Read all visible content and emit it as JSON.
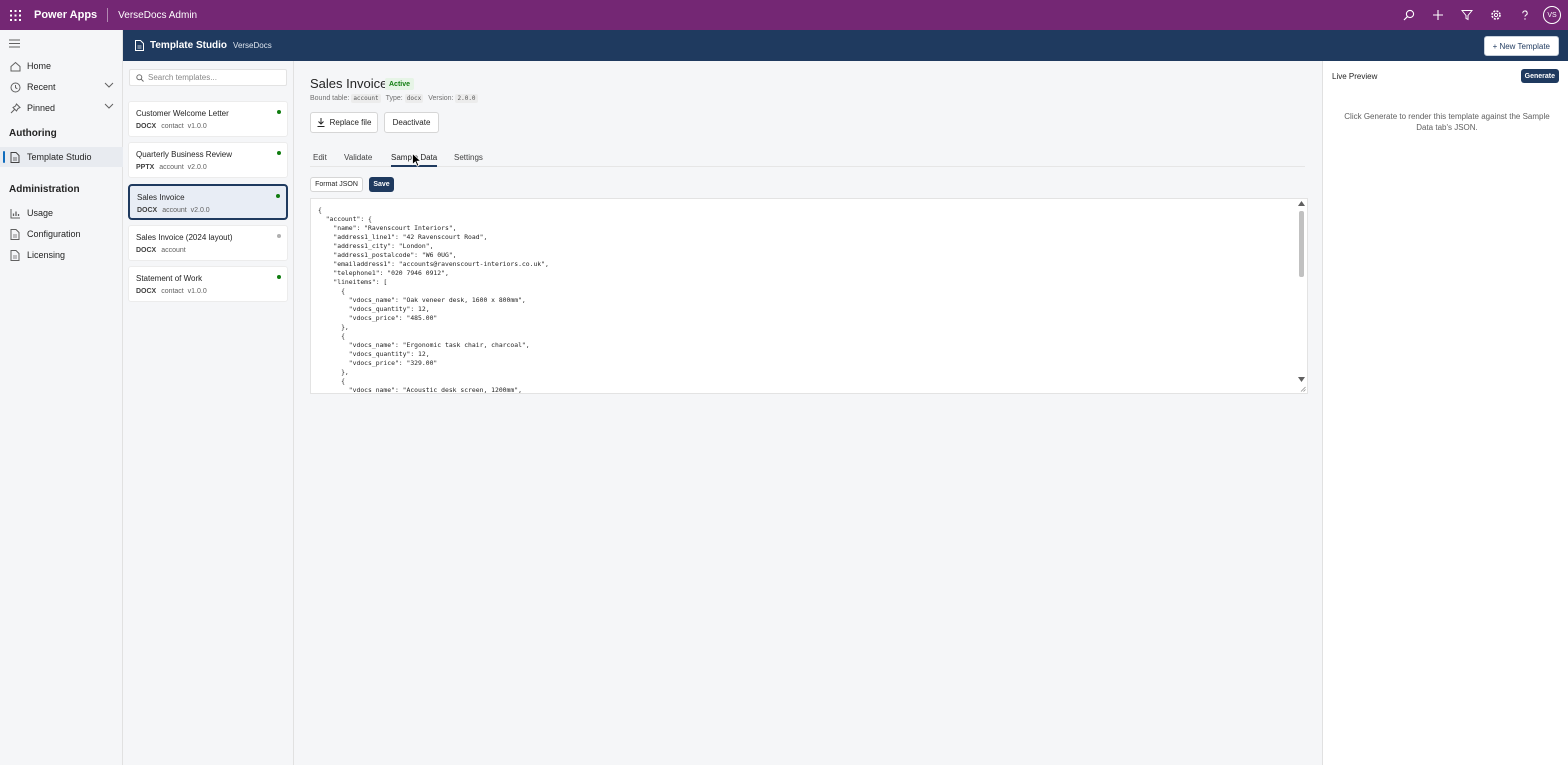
{
  "topbar": {
    "brand": "Power Apps",
    "environment": "VerseDocs Admin",
    "avatar": "VS",
    "icons": [
      "search-icon",
      "add-icon",
      "filter-icon",
      "settings-icon",
      "help-icon"
    ]
  },
  "nav": {
    "items": [
      {
        "label": "Home",
        "icon": "home-icon"
      },
      {
        "label": "Recent",
        "icon": "clock-icon"
      },
      {
        "label": "Pinned",
        "icon": "pin-icon"
      }
    ],
    "authoring_heading": "Authoring",
    "authoring_items": [
      {
        "label": "Template Studio",
        "icon": "document-icon",
        "selected": true
      }
    ],
    "administration_heading": "Administration",
    "administration_items": [
      {
        "label": "Usage",
        "icon": "chart-icon"
      },
      {
        "label": "Configuration",
        "icon": "document-icon"
      },
      {
        "label": "Licensing",
        "icon": "document-icon"
      }
    ]
  },
  "app_header": {
    "title": "Template Studio",
    "subtitle": "VerseDocs",
    "new_template_label": "+ New Template"
  },
  "template_list": {
    "search_placeholder": "Search templates...",
    "templates": [
      {
        "name": "Customer Welcome Letter",
        "type": "DOCX",
        "table": "contact",
        "version": "v1.0.0",
        "status_color": "#107c10",
        "selected": false
      },
      {
        "name": "Quarterly Business Review",
        "type": "PPTX",
        "table": "account",
        "version": "v2.0.0",
        "status_color": "#107c10",
        "selected": false
      },
      {
        "name": "Sales Invoice",
        "type": "DOCX",
        "table": "account",
        "version": "v2.0.0",
        "status_color": "#107c10",
        "selected": true
      },
      {
        "name": "Sales Invoice (2024 layout)",
        "type": "DOCX",
        "table": "account",
        "version": "",
        "status_color": "#b0b0b0",
        "selected": false
      },
      {
        "name": "Statement of Work",
        "type": "DOCX",
        "table": "contact",
        "version": "v1.0.0",
        "status_color": "#107c10",
        "selected": false
      }
    ]
  },
  "detail": {
    "title": "Sales Invoice",
    "status": "Active",
    "bound_table_label": "Bound table:",
    "bound_table": "account",
    "type_label": "Type:",
    "type": "docx",
    "version_label": "Version:",
    "version": "2.0.0",
    "replace_file_label": "Replace file",
    "deactivate_label": "Deactivate",
    "tabs": [
      "Edit",
      "Validate",
      "Sample Data",
      "Settings"
    ],
    "active_tab": "Sample Data",
    "format_json_label": "Format JSON",
    "save_label": "Save",
    "json_lines": [
      "{",
      "  \"account\": {",
      "    \"name\": \"Ravenscourt Interiors\",",
      "    \"address1_line1\": \"42 Ravenscourt Road\",",
      "    \"address1_city\": \"London\",",
      "    \"address1_postalcode\": \"W6 0UG\",",
      "    \"emailaddress1\": \"accounts@ravenscourt-interiors.co.uk\",",
      "    \"telephone1\": \"020 7946 0912\",",
      "    \"lineitems\": [",
      "      {",
      "        \"vdocs_name\": \"Oak veneer desk, 1600 x 800mm\",",
      "        \"vdocs_quantity\": 12,",
      "        \"vdocs_price\": \"485.00\"",
      "      },",
      "      {",
      "        \"vdocs_name\": \"Ergonomic task chair, charcoal\",",
      "        \"vdocs_quantity\": 12,",
      "        \"vdocs_price\": \"329.00\"",
      "      },",
      "      {",
      "        \"vdocs_name\": \"Acoustic desk screen, 1200mm\","
    ]
  },
  "preview": {
    "title": "Live Preview",
    "generate_label": "Generate",
    "message": "Click Generate to render this template against the Sample Data tab's JSON."
  },
  "colors": {
    "topbar": "#742774",
    "app_header": "#1f3a5f",
    "active_status": "#107c10",
    "inactive_status": "#b0b0b0"
  }
}
